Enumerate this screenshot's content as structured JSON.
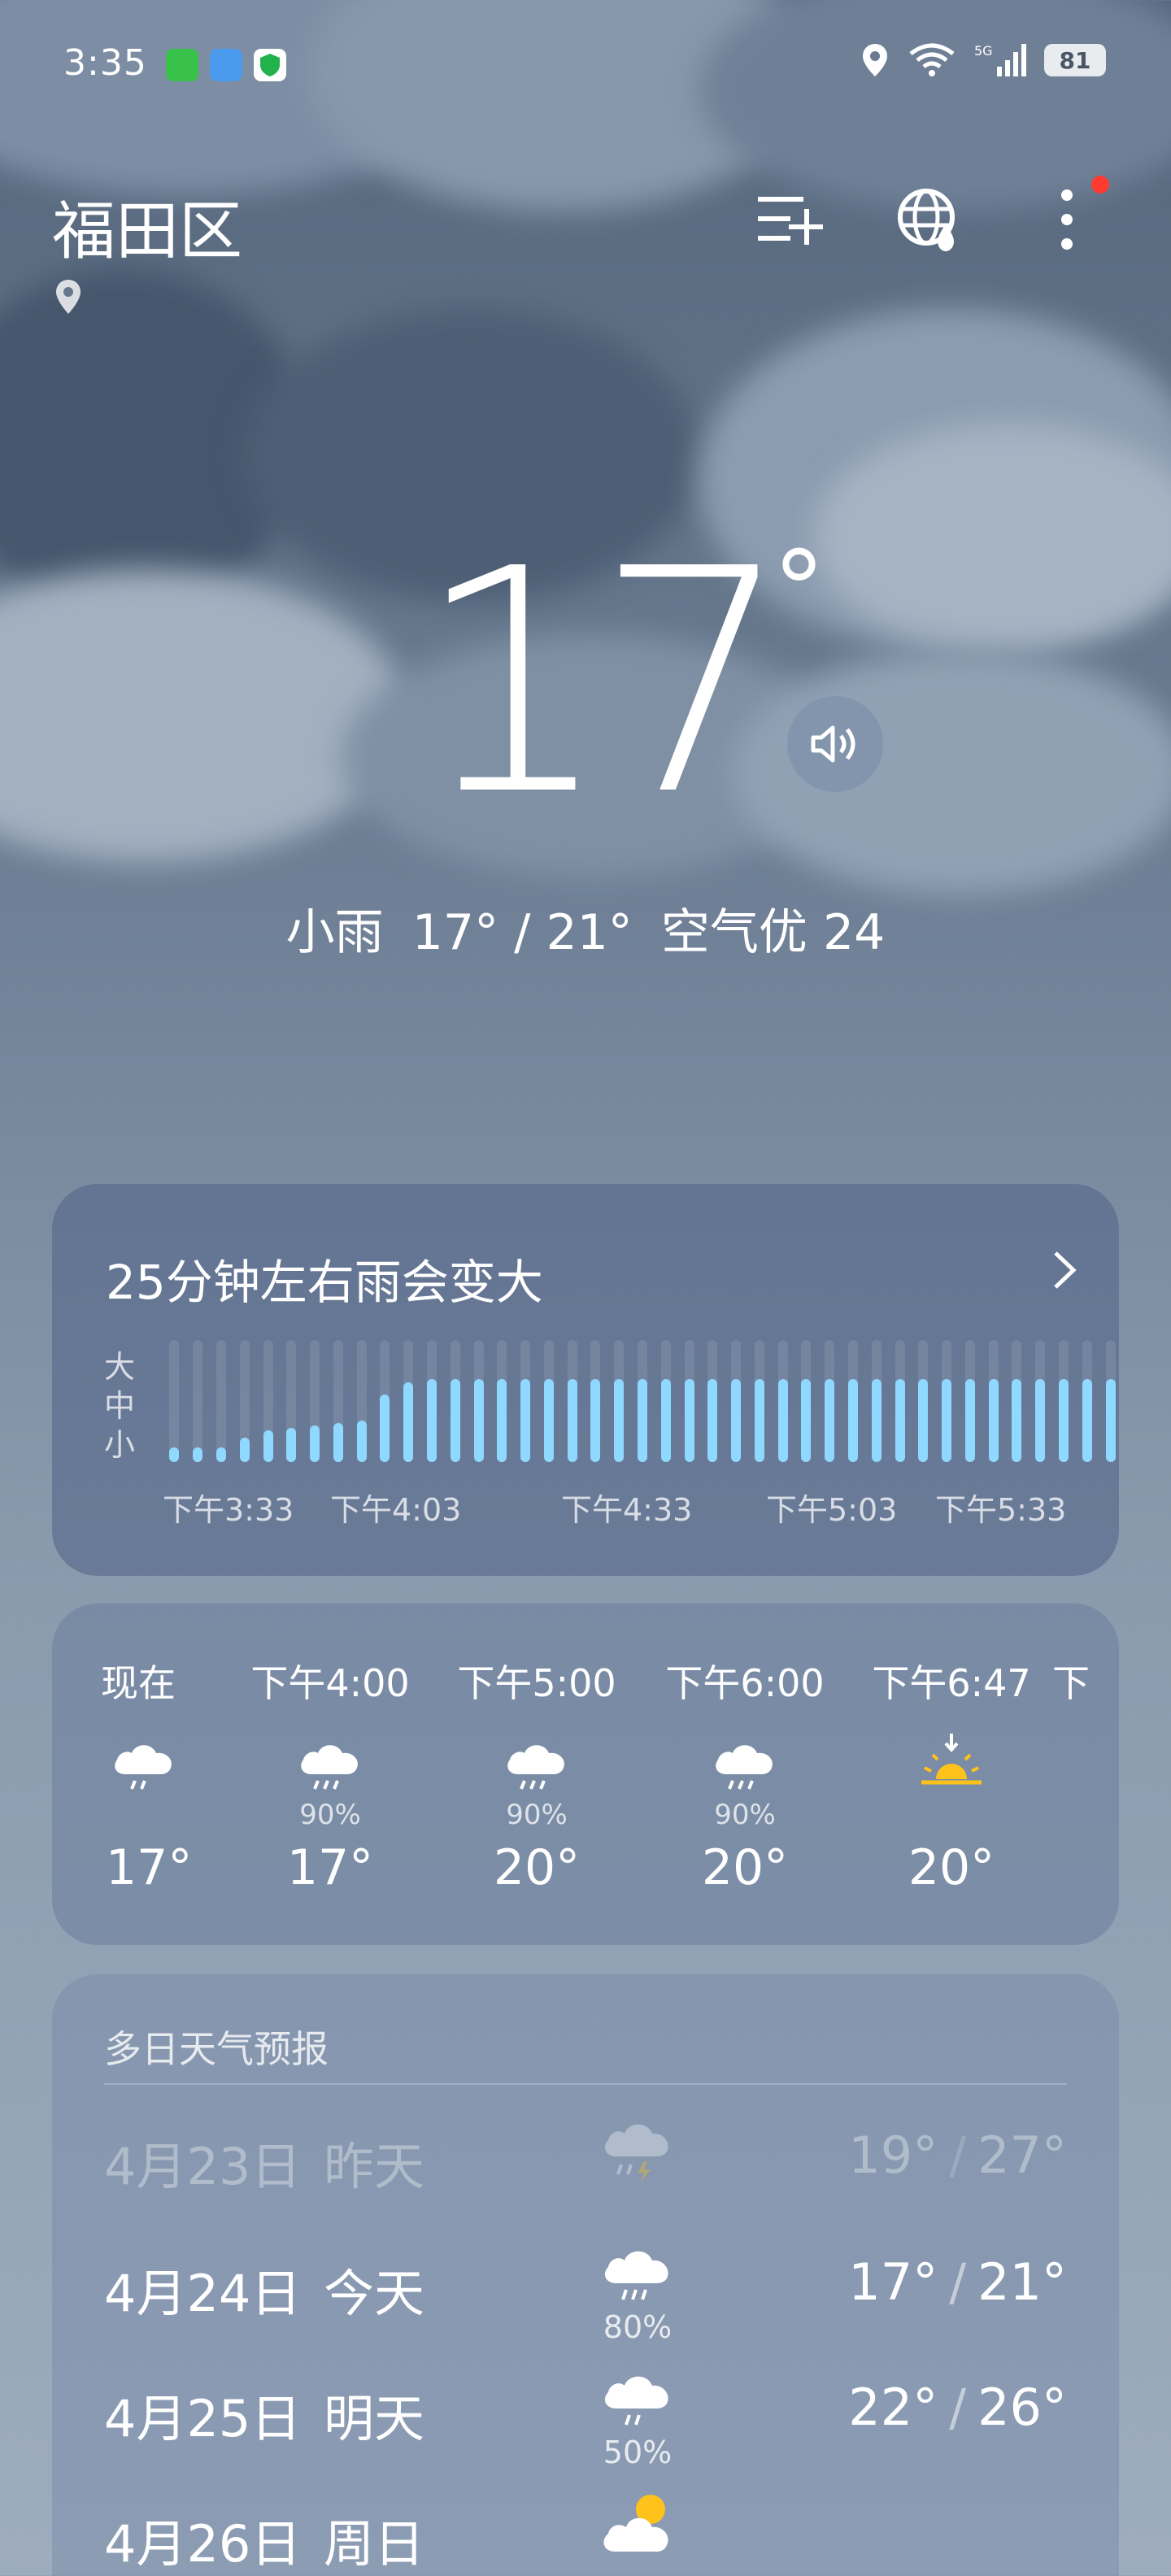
{
  "status_bar": {
    "time": "3:35",
    "battery": "81",
    "signal_label": "5G"
  },
  "header": {
    "city": "福田区"
  },
  "current": {
    "temperature": "17",
    "degree_symbol": "°",
    "condition": "小雨",
    "range": "17° / 21°",
    "air_quality": "空气优 24"
  },
  "rain_alert": {
    "title": "25分钟左右雨会变大",
    "axis_labels": [
      "大",
      "中",
      "小"
    ],
    "time_ticks": [
      "下午3:33",
      "下午4:03",
      "下午4:33",
      "下午5:03",
      "下午5:33"
    ],
    "intensity": [
      0.12,
      0.12,
      0.12,
      0.2,
      0.26,
      0.28,
      0.3,
      0.32,
      0.34,
      0.55,
      0.65,
      0.68,
      0.68,
      0.68,
      0.68,
      0.68,
      0.68,
      0.68,
      0.68,
      0.68,
      0.68,
      0.68,
      0.68,
      0.68,
      0.68,
      0.68,
      0.68,
      0.68,
      0.68,
      0.68,
      0.68,
      0.68,
      0.68,
      0.68,
      0.68,
      0.68,
      0.68,
      0.68,
      0.68,
      0.68,
      0.68
    ]
  },
  "hourly": [
    {
      "time": "现在",
      "icon": "rain-cloud-icon",
      "prob": "",
      "temp": "17°"
    },
    {
      "time": "下午4:00",
      "icon": "rain-cloud-icon",
      "prob": "90%",
      "temp": "17°"
    },
    {
      "time": "下午5:00",
      "icon": "rain-cloud-icon",
      "prob": "90%",
      "temp": "20°"
    },
    {
      "time": "下午6:00",
      "icon": "rain-cloud-icon",
      "prob": "90%",
      "temp": "20°"
    },
    {
      "time": "下午6:47",
      "icon": "sunset-icon",
      "prob": "",
      "temp": "20°"
    },
    {
      "time": "下",
      "icon": "",
      "prob": "",
      "temp": ""
    }
  ],
  "forecast": {
    "title": "多日天气预报",
    "days": [
      {
        "date": "4月23日",
        "day": "昨天",
        "icon": "thunder-rain-icon",
        "prob": "",
        "low": "19°",
        "high": "27°",
        "past": true
      },
      {
        "date": "4月24日",
        "day": "今天",
        "icon": "rain-cloud-icon",
        "prob": "80%",
        "low": "17°",
        "high": "21°",
        "past": false
      },
      {
        "date": "4月25日",
        "day": "明天",
        "icon": "rain-cloud-icon",
        "prob": "50%",
        "low": "22°",
        "high": "26°",
        "past": false
      },
      {
        "date": "4月26日",
        "day": "周日",
        "icon": "partly-cloudy-icon",
        "prob": "",
        "low": "",
        "high": "",
        "past": false
      }
    ]
  },
  "colors": {
    "rain_bar": "#8fd8ff",
    "sun": "#ffc21a",
    "notification_dot": "#ff3b30"
  }
}
